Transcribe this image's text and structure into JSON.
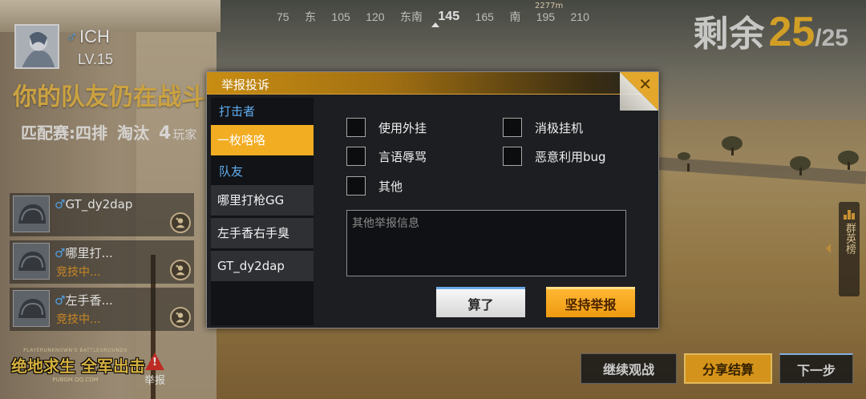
{
  "compass": {
    "ticks": [
      "75",
      "东",
      "105",
      "120",
      "东南",
      "145",
      "165",
      "南",
      "195",
      "210"
    ],
    "center_index": 5,
    "marker_distance": "2277m"
  },
  "remaining": {
    "label": "剩余",
    "count": "25",
    "total": "/25"
  },
  "player": {
    "gender_symbol": "♂",
    "name": "ICH",
    "level": "LV.15"
  },
  "headline": "你的队友仍在战斗",
  "match": {
    "mode": "匹配赛:四排",
    "elim_label": "淘汰",
    "elim_count": "4",
    "players_label": "玩家"
  },
  "teammates": [
    {
      "gender_symbol": "♂",
      "name": "GT_dy2dap",
      "status": ""
    },
    {
      "gender_symbol": "♂",
      "name": "哪里打...",
      "status": "竞技中..."
    },
    {
      "gender_symbol": "♂",
      "name": "左手香...",
      "status": "竞技中..."
    }
  ],
  "logo": {
    "top": "PLAYERUNKNOWN'S BATTLEGROUNDS",
    "main": "绝地求生 全军出击",
    "sub": "PUBGM.QQ.COM"
  },
  "report_button": {
    "icon_text": "!",
    "label": "举报"
  },
  "leaderboard": {
    "label": "群英榜"
  },
  "bottom_buttons": {
    "continue": "继续观战",
    "share": "分享结算",
    "next": "下一步"
  },
  "dialog": {
    "title": "举报投诉",
    "close_label": "✕",
    "attacker_section": "打击者",
    "attacker": "一枚咯咯",
    "teammate_section": "队友",
    "teammates": [
      "哪里打枪GG",
      "左手香右手臭",
      "GT_dy2dap"
    ],
    "reasons": [
      "使用外挂",
      "消极挂机",
      "言语辱骂",
      "恶意利用bug",
      "其他"
    ],
    "other_placeholder": "其他举报信息",
    "other_value": "",
    "cancel": "算了",
    "submit": "坚持举报"
  },
  "colors": {
    "accent": "#f2ad23",
    "headline": "#e7b94a",
    "male": "#5ab4ff",
    "status": "#e59a28",
    "section": "#5faef0"
  }
}
